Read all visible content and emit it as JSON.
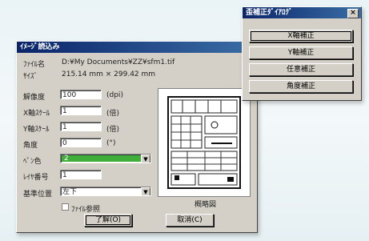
{
  "main_dialog": {
    "title": "ｲﾒｰｼﾞ読込み",
    "file_name_label": "ﾌｧｲﾙ名",
    "file_name_value": "D:¥My Documents¥ZZ¥sfm1.tif",
    "size_label": "ｻｲｽﾞ",
    "size_value": "215.14 mm × 299.42 mm",
    "resolution_label": "解像度",
    "resolution_value": "100",
    "resolution_unit": "(dpi)",
    "x_scale_label": "X軸ｽｹｰﾙ",
    "x_scale_value": "1",
    "x_scale_unit": "(倍)",
    "y_scale_label": "Y軸ｽｹｰﾙ",
    "y_scale_value": "1",
    "y_scale_unit": "(倍)",
    "angle_label": "角度",
    "angle_value": "0",
    "angle_unit": "(°)",
    "color_label": "ﾍﾟﾝ色",
    "color_value": "2",
    "color_swatch": "#3fae3a",
    "layer_label": "ﾚｲﾔ番号",
    "layer_value": "1",
    "basepoint_label": "基準位置",
    "basepoint_value": "左下",
    "file_ref_label": "ﾌｧｲﾙ参照",
    "preview_caption": "概略図",
    "ok_label": "了解(O)",
    "cancel_label": "取消(C)"
  },
  "correction_dialog": {
    "title": "歪補正ﾀﾞｲｱﾛｸﾞ",
    "close_label": "×",
    "buttons": [
      "X軸補正",
      "Y軸補正",
      "任意補正",
      "角度補正"
    ]
  }
}
